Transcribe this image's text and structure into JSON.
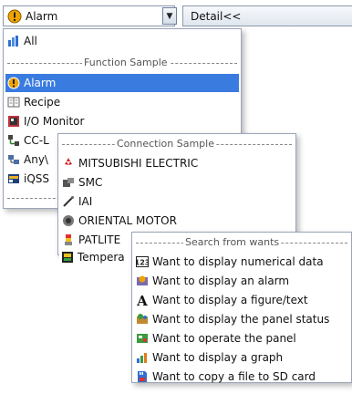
{
  "combo": {
    "value": "Alarm"
  },
  "detail_button": {
    "label": "Detail<<"
  },
  "panel1": {
    "items": [
      {
        "label": "All"
      },
      {
        "label": "Alarm"
      },
      {
        "label": "Recipe"
      },
      {
        "label": "I/O Monitor"
      },
      {
        "label": "CC-L"
      },
      {
        "label": "Any\\"
      },
      {
        "label": "iQSS"
      }
    ],
    "separator": "Function Sample"
  },
  "panel2": {
    "separator": "Connection Sample",
    "items": [
      {
        "label": "MITSUBISHI ELECTRIC"
      },
      {
        "label": "SMC"
      },
      {
        "label": "IAI"
      },
      {
        "label": "ORIENTAL MOTOR"
      },
      {
        "label": "PATLITE"
      },
      {
        "label": "Tempera"
      }
    ]
  },
  "panel3": {
    "separator": "Search from wants",
    "items": [
      {
        "label": "Want to display numerical data"
      },
      {
        "label": "Want to display an alarm"
      },
      {
        "label": "Want to display a figure/text"
      },
      {
        "label": "Want to display the panel status"
      },
      {
        "label": "Want to operate the panel"
      },
      {
        "label": "Want to display a graph"
      },
      {
        "label": "Want to copy a file to SD card"
      }
    ]
  },
  "colors": {
    "selection": "#3a7be0",
    "alarm_icon": "#f0a400"
  },
  "icons": [
    "alarm-icon",
    "chevron-down-icon",
    "all-icon",
    "recipe-icon",
    "io-monitor-icon",
    "cc-link-icon",
    "any-icon",
    "iqss-icon",
    "mitsubishi-icon",
    "smc-icon",
    "iai-icon",
    "oriental-motor-icon",
    "patlite-icon",
    "temperature-icon",
    "numerical-icon",
    "alarm-want-icon",
    "text-icon",
    "panel-status-icon",
    "operate-icon",
    "graph-icon",
    "sd-card-icon"
  ]
}
